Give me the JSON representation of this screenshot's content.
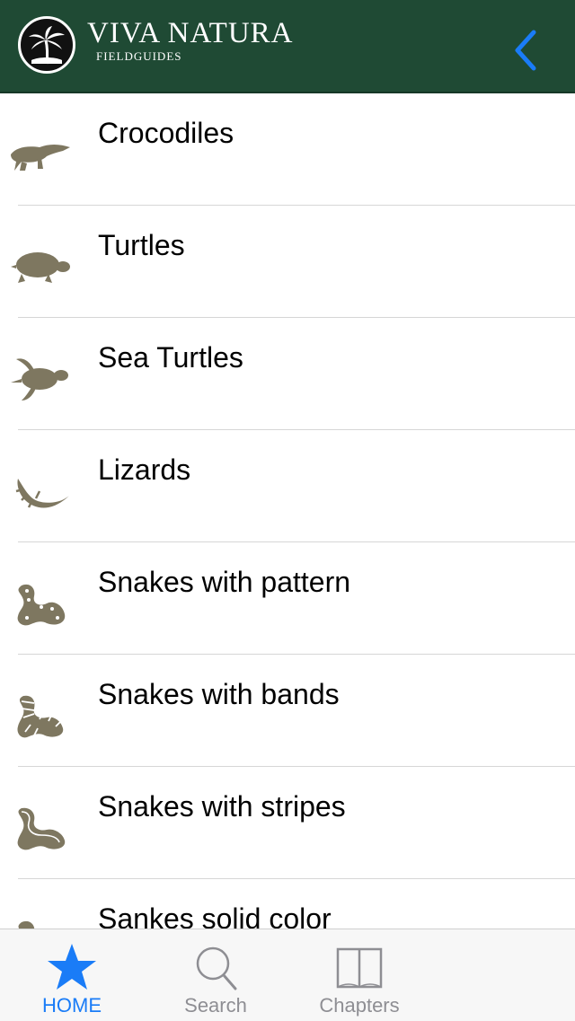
{
  "header": {
    "title": "VIVA NATURA",
    "subtitle": "FIELDGUIDES",
    "logo_icon": "palm-tree-logo-icon",
    "back_icon": "chevron-left-icon",
    "colors": {
      "bar": "#1f4a34",
      "accent": "#1a7cf7"
    }
  },
  "list": {
    "icon_color": "#7e7760",
    "items": [
      {
        "label": "Crocodiles",
        "icon": "crocodile-icon"
      },
      {
        "label": "Turtles",
        "icon": "turtle-icon"
      },
      {
        "label": "Sea Turtles",
        "icon": "sea-turtle-icon"
      },
      {
        "label": "Lizards",
        "icon": "lizard-icon"
      },
      {
        "label": "Snakes with pattern",
        "icon": "patterned-snake-icon"
      },
      {
        "label": "Snakes with bands",
        "icon": "banded-snake-icon"
      },
      {
        "label": "Snakes with stripes",
        "icon": "striped-snake-icon"
      },
      {
        "label": "Sankes solid color",
        "icon": "solid-snake-icon"
      }
    ]
  },
  "tabbar": {
    "tabs": [
      {
        "label": "HOME",
        "icon": "star-icon",
        "active": true
      },
      {
        "label": "Search",
        "icon": "search-icon",
        "active": false
      },
      {
        "label": "Chapters",
        "icon": "book-icon",
        "active": false
      }
    ]
  }
}
